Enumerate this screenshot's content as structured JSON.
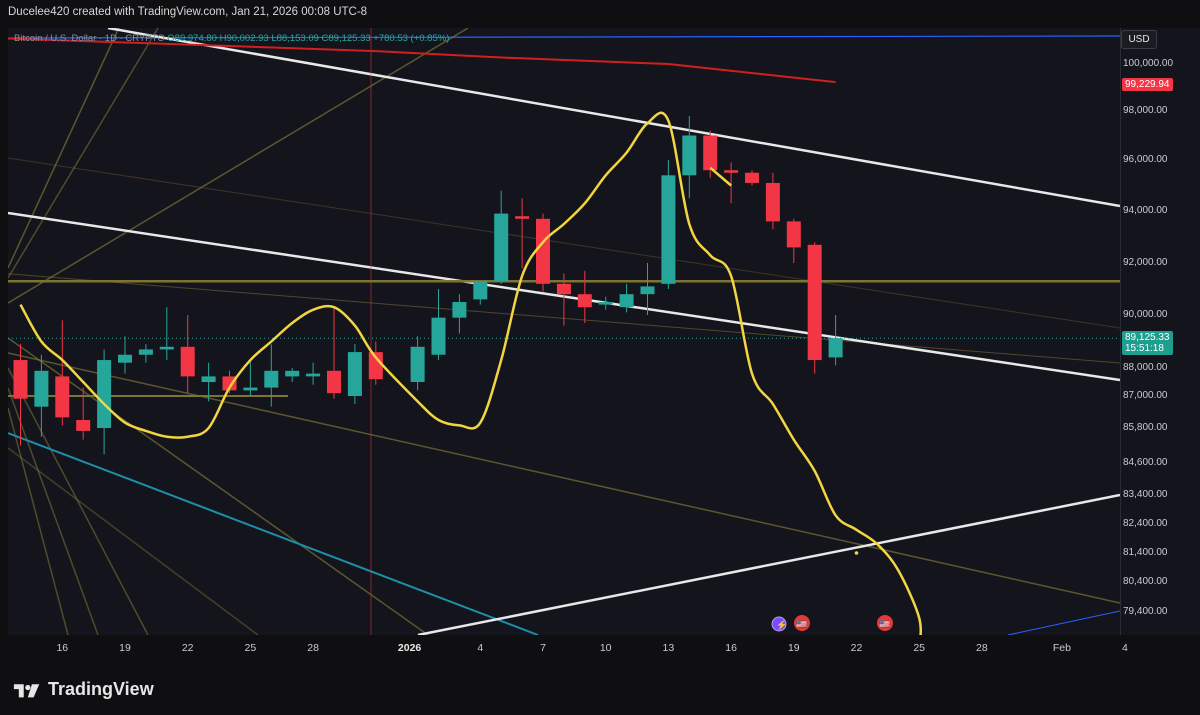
{
  "header": {
    "text": "Ducelee420 created with TradingView.com, Jan 21, 2026 00:08 UTC-8"
  },
  "symbol": {
    "name": "Bitcoin / U.S. Dollar · 1D · CRYPTO",
    "open": "O89,974.80",
    "high": "H90,002.93",
    "low": "L88,153.09",
    "close": "C89,125.33",
    "change": "+780.53 (+0.85%)"
  },
  "yaxis": {
    "currency": "USD",
    "ticks": [
      "100,000.00",
      "98,000.00",
      "96,000.00",
      "94,000.00",
      "92,000.00",
      "90,000.00",
      "88,000.00",
      "87,000.00",
      "85,800.00",
      "84,600.00",
      "83,400.00",
      "82,400.00",
      "81,400.00",
      "80,400.00",
      "79,400.00"
    ],
    "tag_red": "99,229.94",
    "tag_price": "89,125.33",
    "tag_countdown": "15:51:18"
  },
  "xaxis": {
    "ticks": [
      "16",
      "19",
      "22",
      "25",
      "28",
      "2026",
      "4",
      "7",
      "10",
      "13",
      "16",
      "19",
      "22",
      "25",
      "28",
      "Feb",
      "4"
    ]
  },
  "brand": {
    "name": "TradingView"
  },
  "colors": {
    "up": "#26a69a",
    "down": "#f23645",
    "yellow": "#f2d541",
    "white": "#e8e8e8",
    "cyan": "#1f8ea8",
    "olive": "#6f6a3a",
    "red_ma": "#d11f1f",
    "blue_line": "#2962ff"
  },
  "chart_data": {
    "type": "candlestick",
    "symbol": "Bitcoin / U.S. Dollar · 1D · CRYPTO",
    "candles": [
      {
        "date": "Dec 14",
        "o": 88300,
        "h": 88900,
        "l": 85200,
        "c": 86900
      },
      {
        "date": "Dec 15",
        "o": 86600,
        "h": 88500,
        "l": 85500,
        "c": 87900
      },
      {
        "date": "Dec 16",
        "o": 87700,
        "h": 89800,
        "l": 85900,
        "c": 86200
      },
      {
        "date": "Dec 17",
        "o": 86100,
        "h": 87300,
        "l": 85400,
        "c": 85700
      },
      {
        "date": "Dec 18",
        "o": 85800,
        "h": 88700,
        "l": 84900,
        "c": 88300
      },
      {
        "date": "Dec 19",
        "o": 88200,
        "h": 89200,
        "l": 87800,
        "c": 88500
      },
      {
        "date": "Dec 20",
        "o": 88500,
        "h": 88900,
        "l": 88200,
        "c": 88700
      },
      {
        "date": "Dec 21",
        "o": 88700,
        "h": 90300,
        "l": 88300,
        "c": 88800
      },
      {
        "date": "Dec 22",
        "o": 88800,
        "h": 90000,
        "l": 87100,
        "c": 87700
      },
      {
        "date": "Dec 23",
        "o": 87500,
        "h": 88200,
        "l": 86800,
        "c": 87700
      },
      {
        "date": "Dec 24",
        "o": 87700,
        "h": 87900,
        "l": 87100,
        "c": 87200
      },
      {
        "date": "Dec 25",
        "o": 87200,
        "h": 88300,
        "l": 87000,
        "c": 87300
      },
      {
        "date": "Dec 26",
        "o": 87300,
        "h": 88900,
        "l": 86600,
        "c": 87900
      },
      {
        "date": "Dec 27",
        "o": 87700,
        "h": 88000,
        "l": 87500,
        "c": 87900
      },
      {
        "date": "Dec 28",
        "o": 87700,
        "h": 88200,
        "l": 87400,
        "c": 87800
      },
      {
        "date": "Dec 29",
        "o": 87900,
        "h": 90300,
        "l": 86900,
        "c": 87100
      },
      {
        "date": "Dec 30",
        "o": 87000,
        "h": 88900,
        "l": 86700,
        "c": 88600
      },
      {
        "date": "Dec 31",
        "o": 88600,
        "h": 89000,
        "l": 87400,
        "c": 87600
      },
      {
        "date": "Jan 1",
        "o": 87500,
        "h": 89200,
        "l": 87200,
        "c": 88800
      },
      {
        "date": "Jan 2",
        "o": 88500,
        "h": 91000,
        "l": 88300,
        "c": 89900
      },
      {
        "date": "Jan 3",
        "o": 89900,
        "h": 90800,
        "l": 89300,
        "c": 90500
      },
      {
        "date": "Jan 4",
        "o": 90600,
        "h": 91300,
        "l": 90400,
        "c": 91300
      },
      {
        "date": "Jan 5",
        "o": 91300,
        "h": 94800,
        "l": 91200,
        "c": 93900
      },
      {
        "date": "Jan 6",
        "o": 93800,
        "h": 94500,
        "l": 91800,
        "c": 93700
      },
      {
        "date": "Jan 7",
        "o": 93700,
        "h": 93900,
        "l": 90900,
        "c": 91200
      },
      {
        "date": "Jan 8",
        "o": 91200,
        "h": 91600,
        "l": 89600,
        "c": 90800
      },
      {
        "date": "Jan 9",
        "o": 90800,
        "h": 91700,
        "l": 89700,
        "c": 90300
      },
      {
        "date": "Jan 10",
        "o": 90400,
        "h": 90700,
        "l": 90200,
        "c": 90500
      },
      {
        "date": "Jan 11",
        "o": 90300,
        "h": 91200,
        "l": 90100,
        "c": 90800
      },
      {
        "date": "Jan 12",
        "o": 90800,
        "h": 92000,
        "l": 90000,
        "c": 91100
      },
      {
        "date": "Jan 13",
        "o": 91200,
        "h": 96000,
        "l": 91000,
        "c": 95400
      },
      {
        "date": "Jan 14",
        "o": 95400,
        "h": 97800,
        "l": 94500,
        "c": 97000
      },
      {
        "date": "Jan 15",
        "o": 97000,
        "h": 97200,
        "l": 95300,
        "c": 95600
      },
      {
        "date": "Jan 16",
        "o": 95600,
        "h": 95900,
        "l": 94300,
        "c": 95500
      },
      {
        "date": "Jan 17",
        "o": 95500,
        "h": 95600,
        "l": 95000,
        "c": 95100
      },
      {
        "date": "Jan 18",
        "o": 95100,
        "h": 95500,
        "l": 93300,
        "c": 93600
      },
      {
        "date": "Jan 19",
        "o": 93600,
        "h": 93700,
        "l": 92000,
        "c": 92600
      },
      {
        "date": "Jan 20",
        "o": 92700,
        "h": 92800,
        "l": 87800,
        "c": 88300
      },
      {
        "date": "Jan 21",
        "o": 88400,
        "h": 90000,
        "l": 88100,
        "c": 89125
      }
    ],
    "indicator_curve": [
      [
        "Dec 14",
        90400
      ],
      [
        "Dec 15",
        89000
      ],
      [
        "Dec 16",
        88300
      ],
      [
        "Dec 17",
        87500
      ],
      [
        "Dec 18",
        86700
      ],
      [
        "Dec 19",
        86000
      ],
      [
        "Dec 20",
        85700
      ],
      [
        "Dec 21",
        85500
      ],
      [
        "Dec 22",
        85500
      ],
      [
        "Dec 23",
        85800
      ],
      [
        "Dec 24",
        87300
      ],
      [
        "Dec 25",
        88300
      ],
      [
        "Dec 26",
        89000
      ],
      [
        "Dec 27",
        89700
      ],
      [
        "Dec 28",
        90200
      ],
      [
        "Dec 29",
        90300
      ],
      [
        "Dec 30",
        89600
      ],
      [
        "Dec 31",
        88400
      ],
      [
        "Jan 1",
        86800
      ],
      [
        "Jan 2",
        86100
      ],
      [
        "Jan 3",
        85900
      ],
      [
        "Jan 4",
        86000
      ],
      [
        "Jan 5",
        88300
      ],
      [
        "Jan 6",
        91500
      ],
      [
        "Jan 7",
        92800
      ],
      [
        "Jan 8",
        93500
      ],
      [
        "Jan 9",
        94300
      ],
      [
        "Jan 10",
        95400
      ],
      [
        "Jan 11",
        96300
      ],
      [
        "Jan 12",
        97500
      ],
      [
        "Jan 13",
        97600
      ],
      [
        "Jan 14",
        93500
      ],
      [
        "Jan 15",
        92300
      ],
      [
        "Jan 16",
        91500
      ],
      [
        "Jan 17",
        87800
      ],
      [
        "Jan 18",
        86700
      ],
      [
        "Jan 19",
        85400
      ],
      [
        "Jan 20",
        84300
      ],
      [
        "Jan 21",
        82700
      ],
      [
        "Jan 22",
        82200
      ],
      [
        "Jan 23",
        81700
      ],
      [
        "Jan 24",
        80800
      ],
      [
        "Jan 25",
        79200
      ]
    ],
    "indicator_fragment": [
      [
        "Jan 15",
        95700
      ],
      [
        "Jan 16",
        95000
      ]
    ],
    "horizontal_levels": [
      91300,
      87000
    ],
    "red_ma": [
      [
        "Dec 13",
        101200
      ],
      [
        "Dec 31",
        100600
      ],
      [
        "Jan 5",
        100300
      ],
      [
        "Jan 13",
        100000
      ],
      [
        "Jan 21",
        99230
      ]
    ],
    "yellow_dot": [
      "Jan 22",
      81400
    ]
  }
}
